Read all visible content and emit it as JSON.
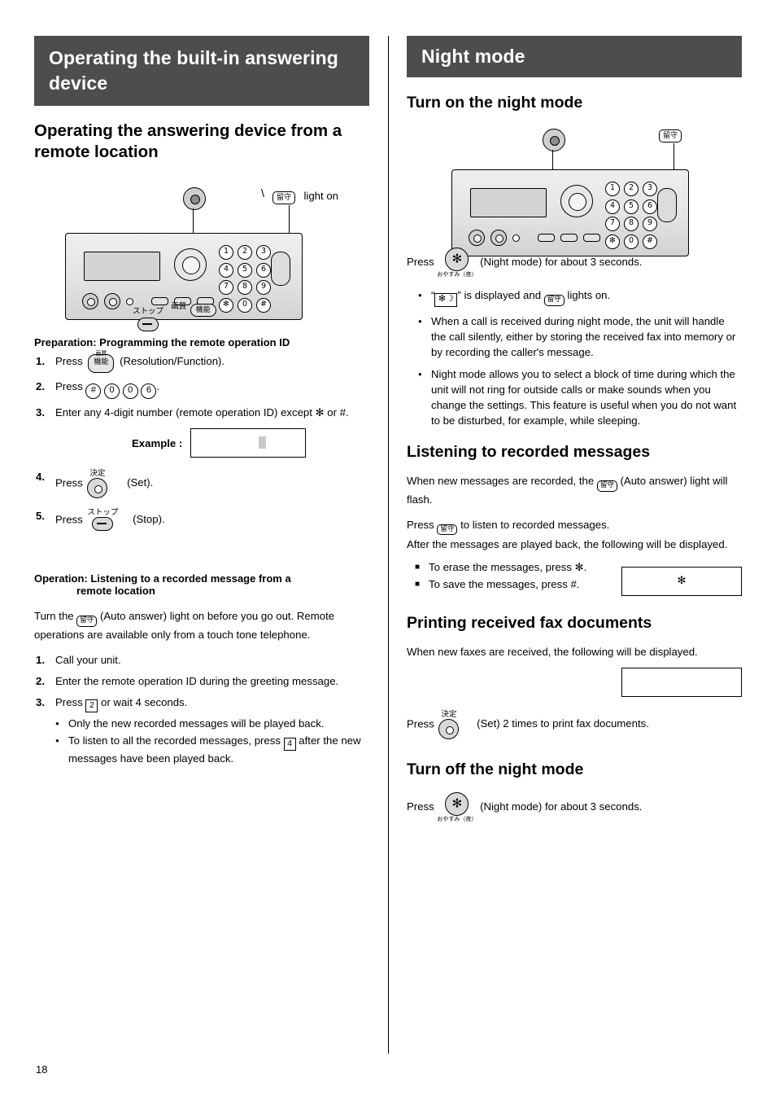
{
  "page_number": "18",
  "left": {
    "header": "Operating the built-in answering device",
    "section_title": "Operating the answering device from a remote location",
    "light_on_label": "light on",
    "figure_labels": {
      "stop": "ストップ",
      "quality": "画質",
      "function": "機能",
      "set": "決定"
    },
    "prep_heading": "Preparation: Programming the remote operation ID",
    "prep_steps": [
      {
        "num": "1.",
        "pre": "Press",
        "post": "(Resolution/Function)."
      },
      {
        "num": "2.",
        "pre": "Press",
        "keys": [
          "#",
          "0",
          "0",
          "6"
        ],
        "post": "."
      },
      {
        "num": "3.",
        "text": "Enter any 4-digit number (remote operation ID) except ✻ or #."
      },
      {
        "num": "4.",
        "pre": "Press",
        "post": "(Set)."
      },
      {
        "num": "5.",
        "pre": "Press",
        "post": "(Stop)."
      }
    ],
    "example_label": "Example :",
    "op_heading_line1": "Operation: Listening to a recorded message from a",
    "op_heading_line2": "remote location",
    "op_intro": "Turn the (Auto answer) light on before you go out. Remote operations are available only from a touch tone telephone.",
    "op_steps": [
      {
        "num": "1.",
        "text": "Call your unit."
      },
      {
        "num": "2.",
        "text": "Enter the remote operation ID during the greeting message."
      },
      {
        "num": "3.",
        "text": "Press 2 or wait 4 seconds."
      }
    ],
    "op_bullets": [
      "Only the new recorded messages will be played back.",
      "To listen to all the recorded messages, press 4 after the new messages have been played back."
    ],
    "op_step3_key": "2",
    "op_bullet2_key": "4"
  },
  "right": {
    "header": "Night mode",
    "turn_on_title": "Turn on the night mode",
    "press_night_pre": "Press",
    "press_night_post": "(Night mode) for about 3 seconds.",
    "night_btn_caption": "おやすみ（夜）",
    "bullets": [
      "\" \" is displayed and lights on.",
      "When a call is received during night mode, the unit will handle the call silently, either by storing the received fax into memory or by recording the caller's message.",
      "Night mode allows you to select a block of time during which the unit will not ring for outside calls or make sounds when you change the settings. This feature is useful when you do not want to be disturbed, for example, while sleeping."
    ],
    "listening_title": "Listening to recorded messages",
    "listening_p1_a": "When new messages are recorded, the",
    "listening_p1_b": "(Auto answer) light will flash.",
    "listening_p2_a": "Press",
    "listening_p2_b": "to listen to recorded messages.",
    "listening_p3": "After the messages are played back, the following will be displayed.",
    "erase_line": "To erase the messages, press ✻.",
    "save_line": "To save the messages, press #.",
    "display_box_1": "✻",
    "printing_title": "Printing received fax documents",
    "printing_p1": "When new faxes are received, the following will be displayed.",
    "printing_press_pre": "Press",
    "printing_press_post": "(Set) 2 times to print fax documents.",
    "printing_set_label": "決定",
    "turn_off_title": "Turn off the night mode",
    "turn_off_pre": "Press",
    "turn_off_post": "(Night mode) for about 3 seconds."
  },
  "keypad_rows": [
    [
      "1",
      "2",
      "3"
    ],
    [
      "4",
      "5",
      "6"
    ],
    [
      "7",
      "8",
      "9"
    ],
    [
      "✻",
      "0",
      "#"
    ]
  ]
}
